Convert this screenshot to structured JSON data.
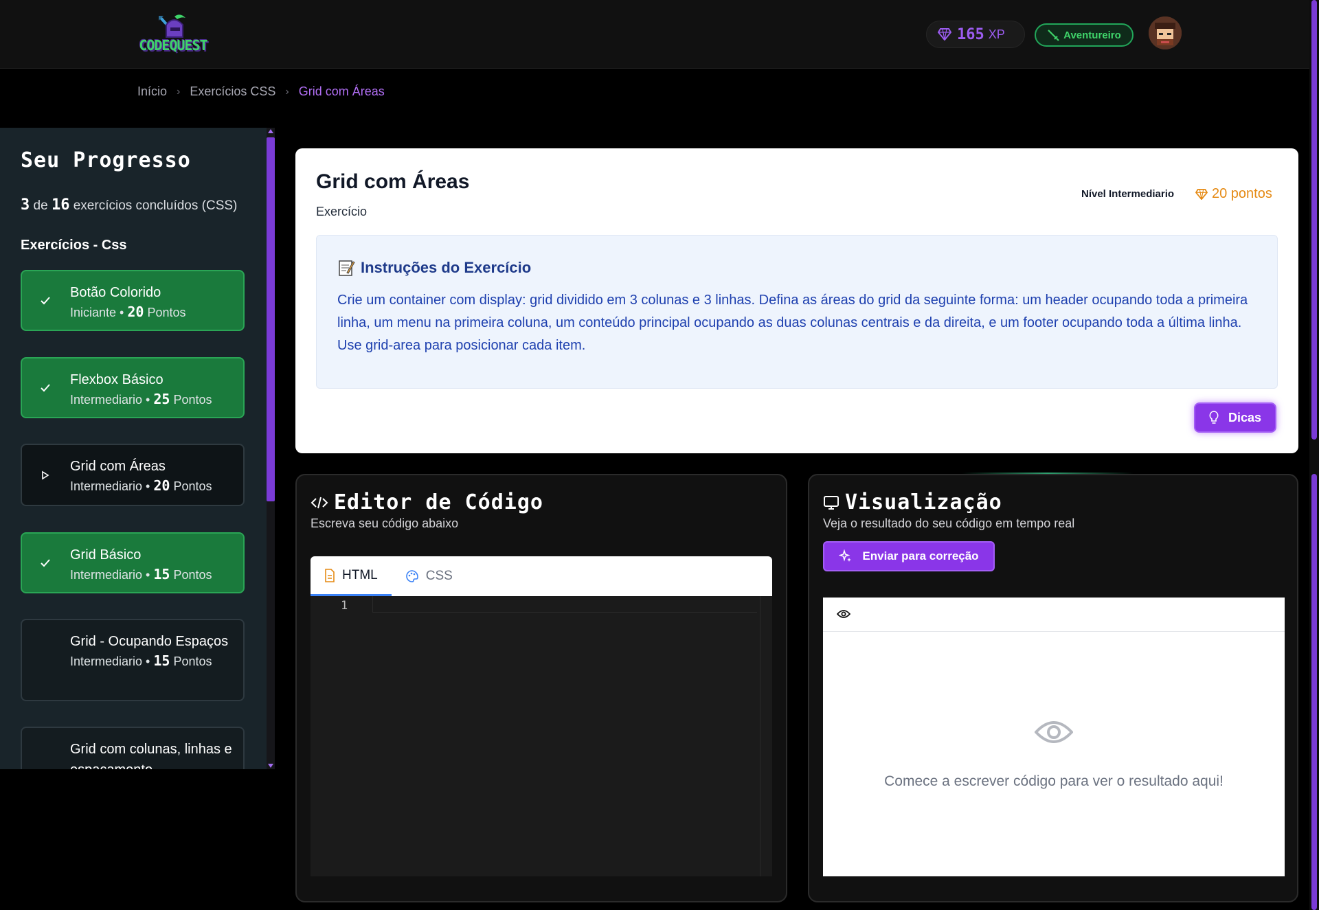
{
  "header": {
    "logo_text": "CODEQUEST",
    "xp_value": "165",
    "xp_unit": "XP",
    "rank_label": "Aventureiro",
    "accent_color": "#8a36e8",
    "success_color": "#1a7a3c"
  },
  "breadcrumb": {
    "items": [
      "Início",
      "Exercícios CSS"
    ],
    "current": "Grid com Áreas"
  },
  "sidebar": {
    "title": "Seu Progresso",
    "progress": {
      "done": "3",
      "of": "de",
      "total": "16",
      "suffix": "exercícios concluídos (CSS)"
    },
    "section": "Exercícios - Css",
    "exercises": [
      {
        "name": "Botão Colorido",
        "level": "Iniciante",
        "points": "20",
        "points_label": "Pontos",
        "status": "done",
        "icon": "check-icon"
      },
      {
        "name": "Flexbox Básico",
        "level": "Intermediario",
        "points": "25",
        "points_label": "Pontos",
        "status": "done",
        "icon": "check-icon"
      },
      {
        "name": "Grid com Áreas",
        "level": "Intermediario",
        "points": "20",
        "points_label": "Pontos",
        "status": "current",
        "icon": "play-icon"
      },
      {
        "name": "Grid Básico",
        "level": "Intermediario",
        "points": "15",
        "points_label": "Pontos",
        "status": "done",
        "icon": "check-icon"
      },
      {
        "name": "Grid - Ocupando Espaços",
        "level": "Intermediario",
        "points": "15",
        "points_label": "Pontos",
        "status": "todo",
        "icon": ""
      },
      {
        "name": "Grid com colunas, linhas e espaçamento",
        "level": "",
        "points": "",
        "points_label": "",
        "status": "todo",
        "icon": ""
      }
    ]
  },
  "exercise": {
    "title": "Grid com Áreas",
    "subtitle": "Exercício",
    "level": "Nível Intermediario",
    "points": "20 pontos",
    "instructions_title": "Instruções do Exercício",
    "instructions_body": "Crie um container com display: grid dividido em 3 colunas e 3 linhas. Defina as áreas do grid da seguinte forma: um header ocupando toda a primeira linha, um menu na primeira coluna, um conteúdo principal ocupando as duas colunas centrais e da direita, e um footer ocupando toda a última linha. Use grid-area para posicionar cada item.",
    "hint_label": "Dicas"
  },
  "editor": {
    "title": "Editor de Código",
    "subtitle": "Escreva seu código abaixo",
    "tabs": [
      {
        "label": "HTML",
        "icon": "file-code-icon",
        "active": true
      },
      {
        "label": "CSS",
        "icon": "palette-icon",
        "active": false
      }
    ],
    "line_number": "1"
  },
  "preview": {
    "title": "Visualização",
    "subtitle": "Veja o resultado do seu código em tempo real",
    "submit_label": "Enviar para correção",
    "empty_text": "Comece a escrever código para ver o resultado aqui!"
  }
}
